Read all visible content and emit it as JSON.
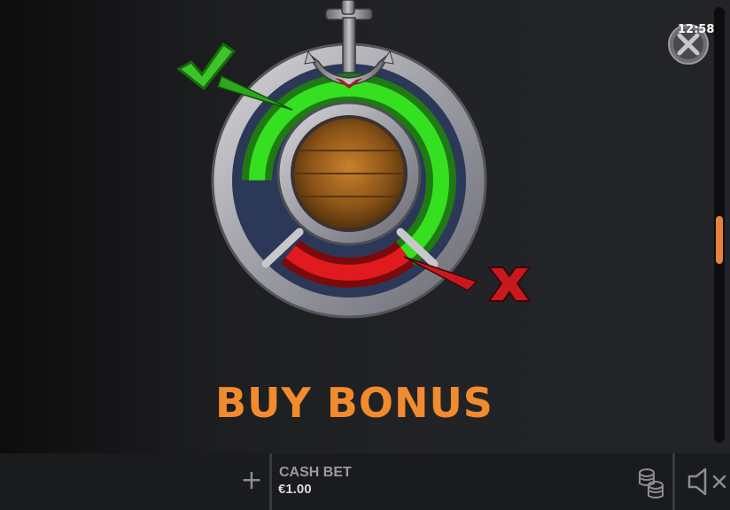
{
  "clock": {
    "time": "12:58"
  },
  "main": {
    "title": "BUY BONUS",
    "confirm_icon": "check-mark-icon",
    "cancel_icon": "x-mark-icon",
    "wheel_icon": "anchor-wheel-icon"
  },
  "bottom_bar": {
    "plus_label": "+",
    "bet_label": "CASH BET",
    "bet_value": "€1.00",
    "coins_icon": "coins-stack-icon",
    "sound_icon": "speaker-muted-icon"
  },
  "colors": {
    "title": "#f28a2e",
    "green_segment": "#2ecc1e",
    "red_segment": "#d4141a",
    "check": "#3cc42a",
    "cross": "#c81a1e",
    "scroll_thumb": "#e8823b"
  }
}
